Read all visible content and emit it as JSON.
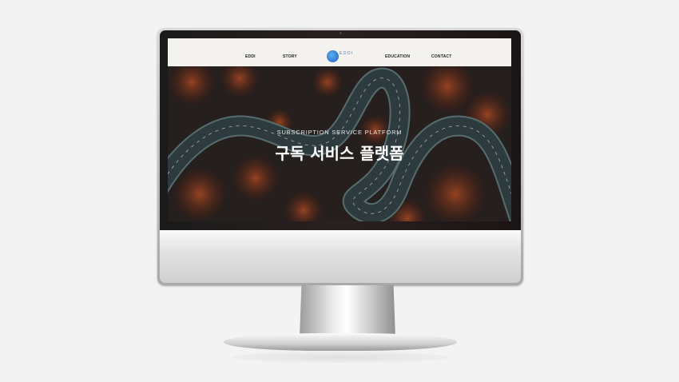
{
  "nav": {
    "items": [
      "EDDI",
      "STORY",
      "EDUCATION",
      "CONTACT"
    ],
    "logo_text": "EDDI"
  },
  "hero": {
    "subtitle": "SUBSCRIPTION SERVICE PLATFORM",
    "title": "구독 서비스 플랫폼"
  },
  "colors": {
    "accent": "#2a7bd4",
    "forest": "#8a3a1e",
    "road": "#3c5458"
  }
}
